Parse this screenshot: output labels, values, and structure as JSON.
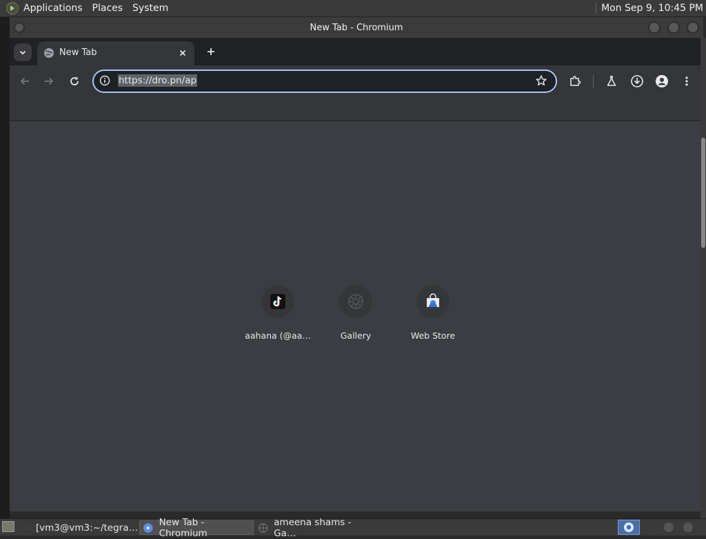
{
  "top_panel": {
    "menu": [
      "Applications",
      "Places",
      "System"
    ],
    "clock": "Mon Sep  9, 10:45 PM"
  },
  "window": {
    "title": "New Tab - Chromium"
  },
  "browser": {
    "tab": {
      "title": "New Tab"
    },
    "omnibox": {
      "url": "https://dro.pn/ap"
    },
    "shortcuts": [
      {
        "label": "aahana (@aa…",
        "icon": "tiktok-icon"
      },
      {
        "label": "Gallery",
        "icon": "gallery-icon"
      },
      {
        "label": "Web Store",
        "icon": "web-store-icon"
      }
    ],
    "accent_color": "#a8c7fa"
  },
  "taskbar": {
    "items": [
      {
        "label": "[vm3@vm3:~/tegra…",
        "icon": "terminal-icon"
      },
      {
        "label": "New Tab - Chromium",
        "icon": "chromium-icon",
        "active": true
      },
      {
        "label": "ameena shams - Ga…",
        "icon": "gallery-icon"
      }
    ]
  }
}
